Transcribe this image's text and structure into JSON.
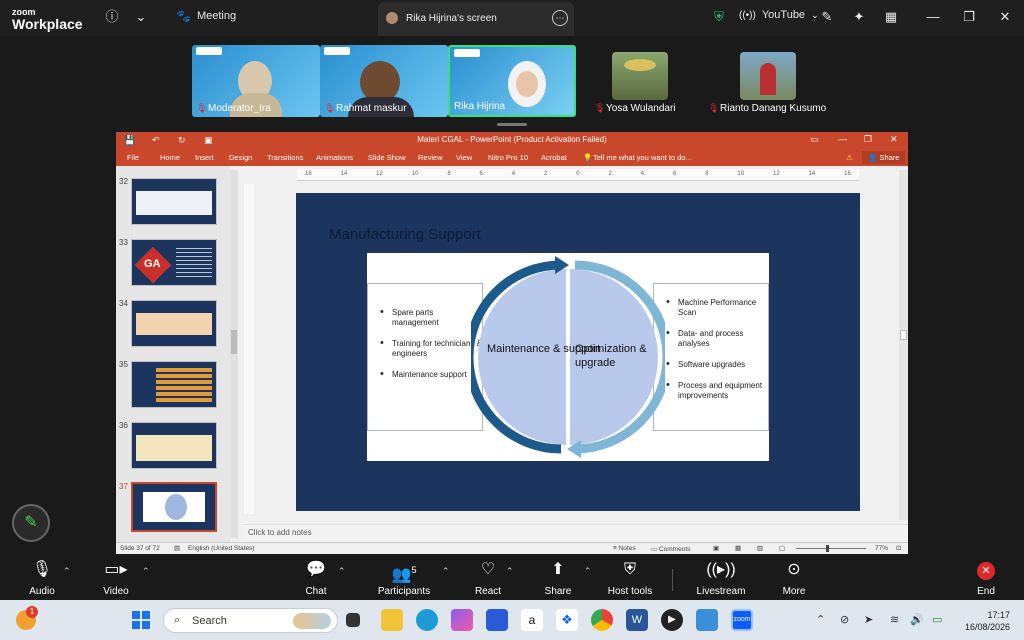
{
  "zoom": {
    "logo_small": "zoom",
    "logo_big": "Workplace",
    "meeting_label": "Meeting",
    "screen_tab_label": "Rika Hijrina's screen",
    "youtube_label": "YouTube",
    "shield_color": "#2fbf71"
  },
  "participants": [
    {
      "name": "Moderator_Ira",
      "muted": true
    },
    {
      "name": "Rahmat maskur",
      "muted": true
    },
    {
      "name": "Rika Hijrina",
      "muted": false,
      "active": true
    },
    {
      "name": "Yosa Wulandari",
      "muted": true
    },
    {
      "name": "Rianto Danang Kusumo",
      "muted": true
    }
  ],
  "powerpoint": {
    "window_title": "Materi CGAL - PowerPoint (Product Activation Failed)",
    "ribbon_tabs": [
      "File",
      "Home",
      "Insert",
      "Design",
      "Transitions",
      "Animations",
      "Slide Show",
      "Review",
      "View",
      "Nitro Pro 10",
      "Acrobat"
    ],
    "tell_me": "Tell me what you want to do...",
    "share": "Share",
    "thumbnails": [
      {
        "num": "32"
      },
      {
        "num": "33"
      },
      {
        "num": "34"
      },
      {
        "num": "35"
      },
      {
        "num": "36"
      },
      {
        "num": "37",
        "selected": true
      }
    ],
    "thumb33_text": "GA",
    "ruler_labels": [
      "16",
      "14",
      "12",
      "10",
      "8",
      "6",
      "4",
      "2",
      "0",
      "2",
      "4",
      "6",
      "8",
      "10",
      "12",
      "14",
      "16"
    ],
    "slide": {
      "title": "Manufacturing Support",
      "left_bullets": [
        "Spare parts management",
        "Training for technicians & engineers",
        "Maintenance support"
      ],
      "left_circle": "Maintenance & support",
      "right_circle": "Optimization & upgrade",
      "right_bullets": [
        "Machine Performance Scan",
        "Data- and process analyses",
        "Software upgrades",
        "Process and equipment improvements"
      ]
    },
    "notes_placeholder": "Click to add notes",
    "status": {
      "slide_info": "Slide 37 of 72",
      "language": "English (United States)",
      "notes": "Notes",
      "comments": "Comments",
      "zoom": "77%"
    }
  },
  "controls": [
    {
      "label": "Audio",
      "icon": "mic-off-icon"
    },
    {
      "label": "Video",
      "icon": "video-icon"
    },
    {
      "label": "Chat",
      "icon": "chat-icon"
    },
    {
      "label": "Participants",
      "icon": "participants-icon",
      "count": "5"
    },
    {
      "label": "React",
      "icon": "heart-icon"
    },
    {
      "label": "Share",
      "icon": "share-icon"
    },
    {
      "label": "Host tools",
      "icon": "shield-icon"
    },
    {
      "label": "Livestream",
      "icon": "livestream-icon"
    },
    {
      "label": "More",
      "icon": "more-icon"
    },
    {
      "label": "End",
      "icon": "end-icon"
    }
  ],
  "taskbar": {
    "search_placeholder": "Search",
    "notification_badge": "1",
    "time": "17:17",
    "date": "16/08/2026"
  }
}
